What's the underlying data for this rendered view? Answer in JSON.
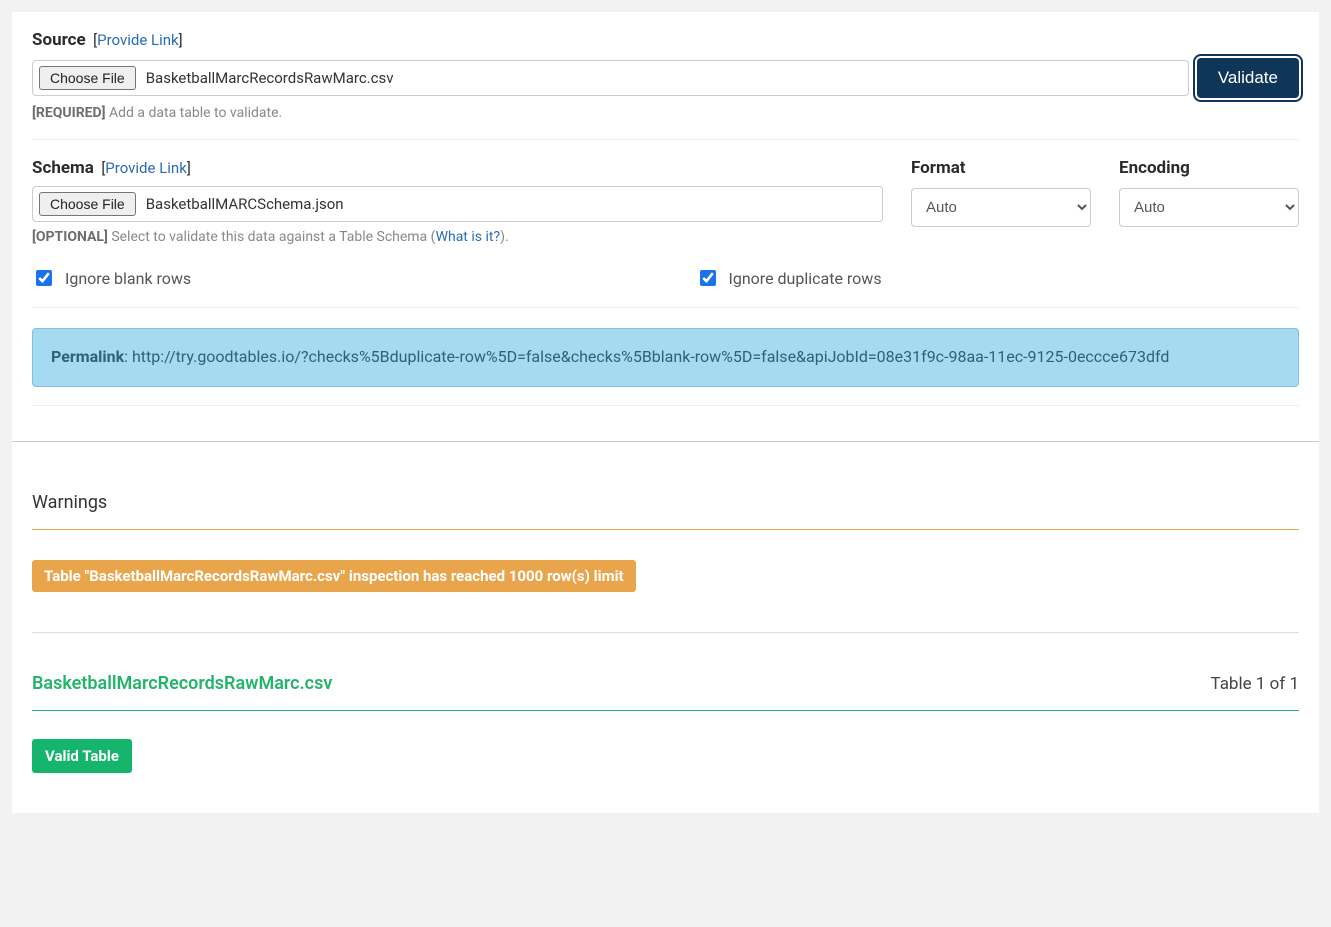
{
  "source": {
    "label": "Source",
    "provide_link": "Provide Link",
    "choose_file": "Choose File",
    "filename": "BasketballMarcRecordsRawMarc.csv",
    "help_prefix": "[REQUIRED]",
    "help_text": " Add a data table to validate."
  },
  "validate_button": "Validate",
  "schema": {
    "label": "Schema",
    "provide_link": "Provide Link",
    "choose_file": "Choose File",
    "filename": "BasketballMARCSchema.json",
    "help_prefix": "[OPTIONAL]",
    "help_text_a": " Select to validate this data against a Table Schema (",
    "help_link": "What is it?",
    "help_text_b": ")."
  },
  "format": {
    "label": "Format",
    "value": "Auto"
  },
  "encoding": {
    "label": "Encoding",
    "value": "Auto"
  },
  "checks": {
    "blank_rows": {
      "label": "Ignore blank rows",
      "checked": true
    },
    "duplicate_rows": {
      "label": "Ignore duplicate rows",
      "checked": true
    }
  },
  "permalink": {
    "label": "Permalink",
    "url": "http://try.goodtables.io/?checks%5Bduplicate-row%5D=false&checks%5Bblank-row%5D=false&apiJobId=08e31f9c-98aa-11ec-9125-0eccce673dfd"
  },
  "warnings": {
    "title": "Warnings",
    "message": "Table \"BasketballMarcRecordsRawMarc.csv\" inspection has reached 1000 row(s) limit"
  },
  "result": {
    "filename": "BasketballMarcRecordsRawMarc.csv",
    "table_count": "Table 1 of 1",
    "status": "Valid Table"
  }
}
